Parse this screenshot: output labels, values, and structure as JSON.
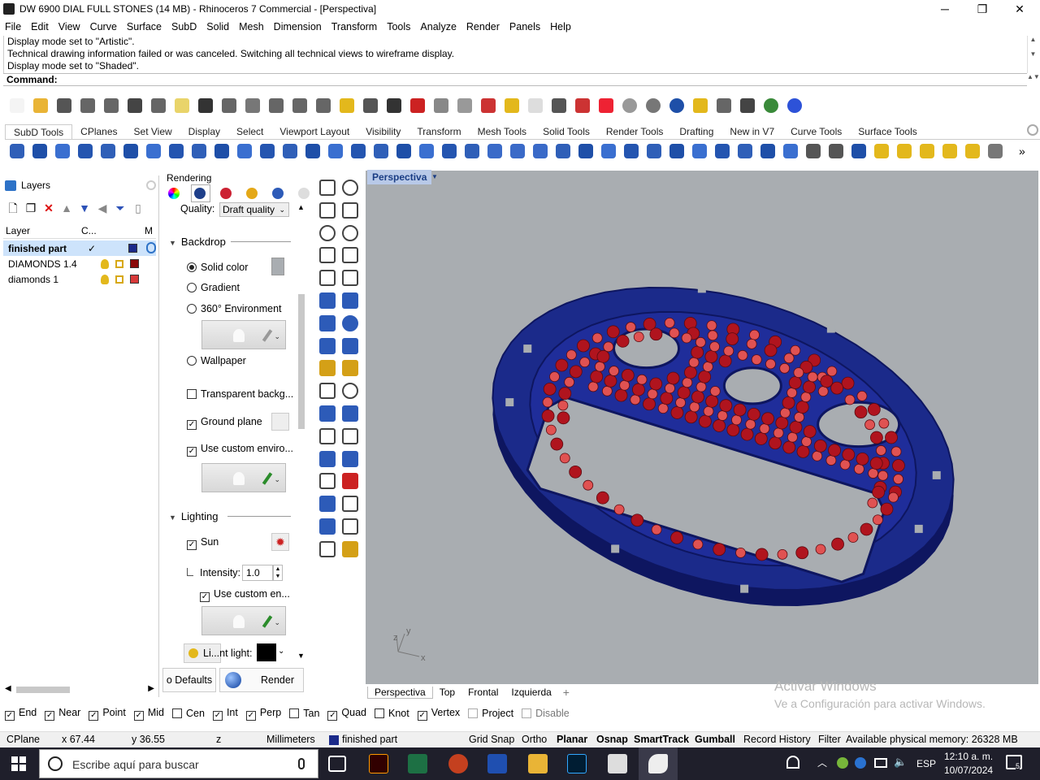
{
  "window": {
    "title": "DW 6900 DIAL FULL STONES (14 MB) - Rhinoceros 7 Commercial - [Perspectiva]",
    "minimize": "─",
    "restore": "❐",
    "close": "✕"
  },
  "menu": [
    "File",
    "Edit",
    "View",
    "Curve",
    "Surface",
    "SubD",
    "Solid",
    "Mesh",
    "Dimension",
    "Transform",
    "Tools",
    "Analyze",
    "Render",
    "Panels",
    "Help"
  ],
  "history": [
    "Display mode set to \"Artistic\".",
    "Technical drawing information failed or was canceled. Switching all technical views to wireframe display.",
    "Display mode set to \"Shaded\"."
  ],
  "command_label": "Command:",
  "tabs": [
    "SubD Tools",
    "CPlanes",
    "Set View",
    "Display",
    "Select",
    "Viewport Layout",
    "Visibility",
    "Transform",
    "Mesh Tools",
    "Solid Tools",
    "Render Tools",
    "Drafting",
    "New in V7",
    "Curve Tools",
    "Surface Tools"
  ],
  "active_tab": "SubD Tools",
  "layers": {
    "tab_label": "Layers",
    "columns": {
      "layer": "Layer",
      "current": "C...",
      "material": "M"
    },
    "rows": [
      {
        "name": "finished part",
        "current": "✓",
        "color": "#1b2a8a",
        "selected": true
      },
      {
        "name": "DIAMONDS 1.4",
        "current": "",
        "color": "#8b0a0a",
        "selected": false
      },
      {
        "name": "diamonds 1",
        "current": "",
        "color": "#d83a3a",
        "selected": false
      }
    ]
  },
  "rendering": {
    "panel_title": "Rendering",
    "quality_label": "Quality:",
    "quality_value": "Draft quality",
    "backdrop": {
      "title": "Backdrop",
      "solid_color": "Solid color",
      "gradient": "Gradient",
      "environment": "360° Environment",
      "wallpaper": "Wallpaper",
      "transparent": "Transparent backg...",
      "ground_plane": "Ground plane",
      "custom_env": "Use custom enviro..."
    },
    "lighting": {
      "title": "Lighting",
      "sun": "Sun",
      "intensity_label": "Intensity:",
      "intensity_value": "1.0",
      "custom_env": "Use custom en...",
      "light_label": "Li...nt light:"
    },
    "defaults_button": "o Defaults",
    "render_button": "Render"
  },
  "viewport": {
    "label": "Perspectiva",
    "tabs": [
      "Perspectiva",
      "Top",
      "Frontal",
      "Izquierda"
    ],
    "add_tab": "+",
    "axes": {
      "x": "x",
      "y": "y",
      "z": "z"
    },
    "model_color": "#1b2a8a",
    "stone_colors": [
      "#b0141e",
      "#e05252"
    ],
    "watermark_title": "Activar Windows",
    "watermark_sub": "Ve a Configuración para activar Windows."
  },
  "osnap": [
    {
      "label": "End",
      "checked": true
    },
    {
      "label": "Near",
      "checked": true
    },
    {
      "label": "Point",
      "checked": true
    },
    {
      "label": "Mid",
      "checked": true
    },
    {
      "label": "Cen",
      "checked": false
    },
    {
      "label": "Int",
      "checked": true
    },
    {
      "label": "Perp",
      "checked": true
    },
    {
      "label": "Tan",
      "checked": false
    },
    {
      "label": "Quad",
      "checked": true
    },
    {
      "label": "Knot",
      "checked": false
    },
    {
      "label": "Vertex",
      "checked": true
    },
    {
      "label": "Project",
      "checked": false
    },
    {
      "label": "Disable",
      "checked": false
    }
  ],
  "status": {
    "cplane": "CPlane",
    "x": "x 67.44",
    "y": "y 36.55",
    "z": "z",
    "units": "Millimeters",
    "layer": "finished part",
    "grid_snap": "Grid Snap",
    "ortho": "Ortho",
    "planar": "Planar",
    "osnap": "Osnap",
    "smarttrack": "SmartTrack",
    "gumball": "Gumball",
    "record_history": "Record History",
    "filter": "Filter",
    "memory": "Available physical memory: 26328 MB"
  },
  "taskbar": {
    "search_placeholder": "Escribe aquí para buscar",
    "language": "ESP",
    "time": "12:10 a. m.",
    "date": "10/07/2024",
    "notifications": "5"
  }
}
